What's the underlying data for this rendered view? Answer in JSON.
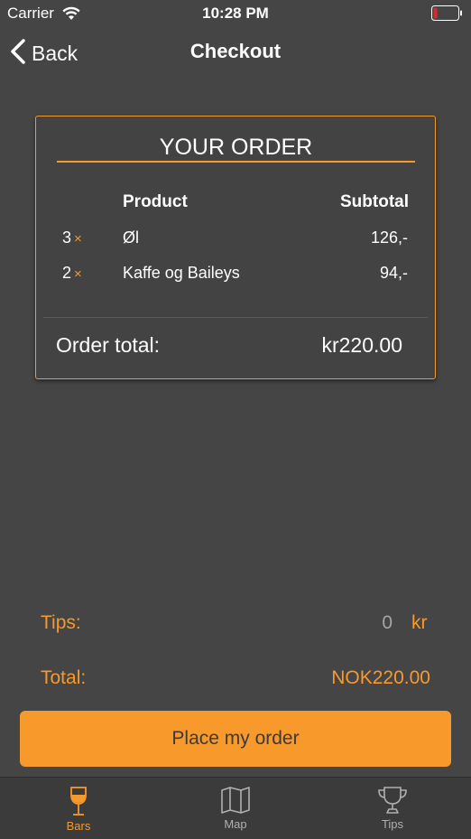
{
  "status_bar": {
    "carrier": "Carrier",
    "time": "10:28 PM",
    "battery_color": "#e0262b"
  },
  "nav": {
    "back_label": "Back",
    "title": "Checkout"
  },
  "order": {
    "title": "YOUR ORDER",
    "columns": {
      "product": "Product",
      "subtotal": "Subtotal"
    },
    "items": [
      {
        "qty": "3",
        "multiplier": "×",
        "name": "Øl",
        "price": "126,-"
      },
      {
        "qty": "2",
        "multiplier": "×",
        "name": "Kaffe og Baileys",
        "price": "94,-"
      }
    ],
    "total_label": "Order total:",
    "total_value": "kr220.00"
  },
  "summary": {
    "tips_label": "Tips:",
    "tips_value": "0",
    "tips_unit": "kr",
    "total_label": "Total:",
    "total_value": "NOK220.00"
  },
  "place_order_label": "Place my order",
  "tabs": [
    {
      "label": "Bars",
      "icon": "wine-glass-icon",
      "active": true
    },
    {
      "label": "Map",
      "icon": "map-icon",
      "active": false
    },
    {
      "label": "Tips",
      "icon": "trophy-icon",
      "active": false
    }
  ],
  "colors": {
    "accent": "#f7992b",
    "background": "#454545",
    "tab_bar": "#3b3b3b"
  }
}
